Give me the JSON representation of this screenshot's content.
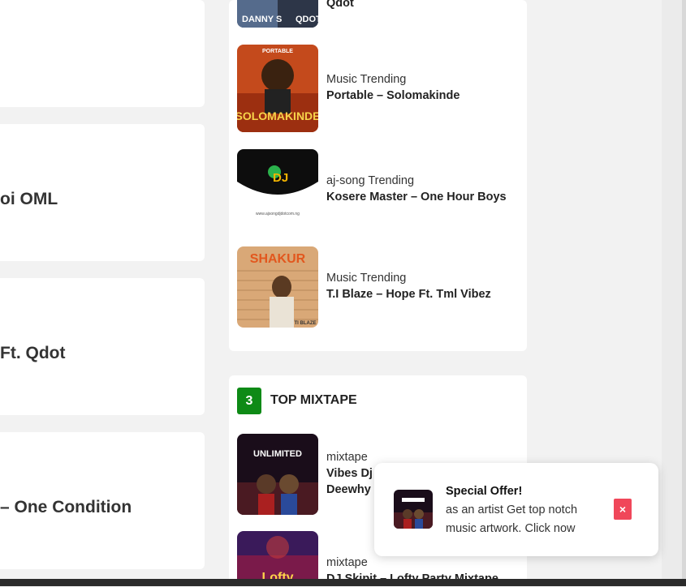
{
  "left_column": {
    "titles": [
      "oi OML",
      "Ft. Qdot",
      "– One Condition"
    ]
  },
  "trending": {
    "items": [
      {
        "category": "",
        "title": "Qdot",
        "art_text_left": "DANNY S",
        "art_text_right": "QDOT"
      },
      {
        "category": "Music Trending",
        "title": "Portable – Solomakinde",
        "art_text_top": "PORTABLE",
        "art_text_big": "SOLOMAKINDE"
      },
      {
        "category": "aj-song Trending",
        "title": "Kosere Master – One Hour Boys",
        "art_text": "DJ",
        "art_caption": "www.ajsongdjdotcom.ng"
      },
      {
        "category": "Music Trending",
        "title": "T.I Blaze – Hope Ft. Tml Vibez",
        "art_text_top": "SHAKUR",
        "art_text_bottom": "TI BLAZE"
      }
    ]
  },
  "top_mixtape": {
    "number": "3",
    "title": "TOP MIXTAPE",
    "items": [
      {
        "category": "mixtape",
        "title_line1": "Vibes Dj",
        "title_line2": "Deewhy ·",
        "art_text": "UNLIMITED"
      },
      {
        "category": "mixtape",
        "title": "DJ Skipit – Lofty Party Mixtape",
        "art_text": "Lofty"
      }
    ]
  },
  "popup": {
    "title": "Special Offer!",
    "text": "as an artist Get top notch music artwork. Click now",
    "close": "×"
  }
}
